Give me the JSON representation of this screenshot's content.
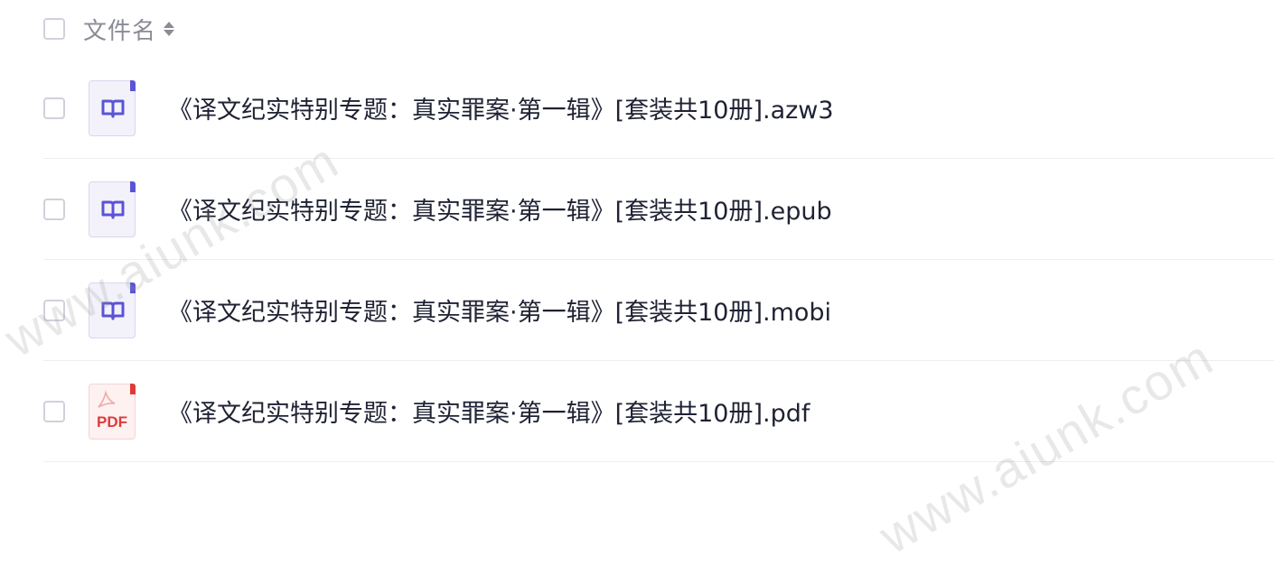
{
  "header": {
    "column_label": "文件名",
    "select_all_checked": false
  },
  "files": [
    {
      "name": "《译文纪实特别专题：真实罪案·第一辑》[套装共10册].azw3",
      "icon": "ebook-icon",
      "checked": false
    },
    {
      "name": "《译文纪实特别专题：真实罪案·第一辑》[套装共10册].epub",
      "icon": "ebook-icon",
      "checked": false
    },
    {
      "name": "《译文纪实特别专题：真实罪案·第一辑》[套装共10册].mobi",
      "icon": "ebook-icon",
      "checked": false
    },
    {
      "name": "《译文纪实特别专题：真实罪案·第一辑》[套装共10册].pdf",
      "icon": "pdf-icon",
      "icon_label": "PDF",
      "checked": false
    }
  ],
  "watermarks": [
    "www.aiunk.com",
    "www.aiunk.com"
  ],
  "colors": {
    "ebook_accent": "#5b54d6",
    "pdf_accent": "#e03a3a",
    "text": "#1f2233",
    "muted": "#8a8c94"
  }
}
